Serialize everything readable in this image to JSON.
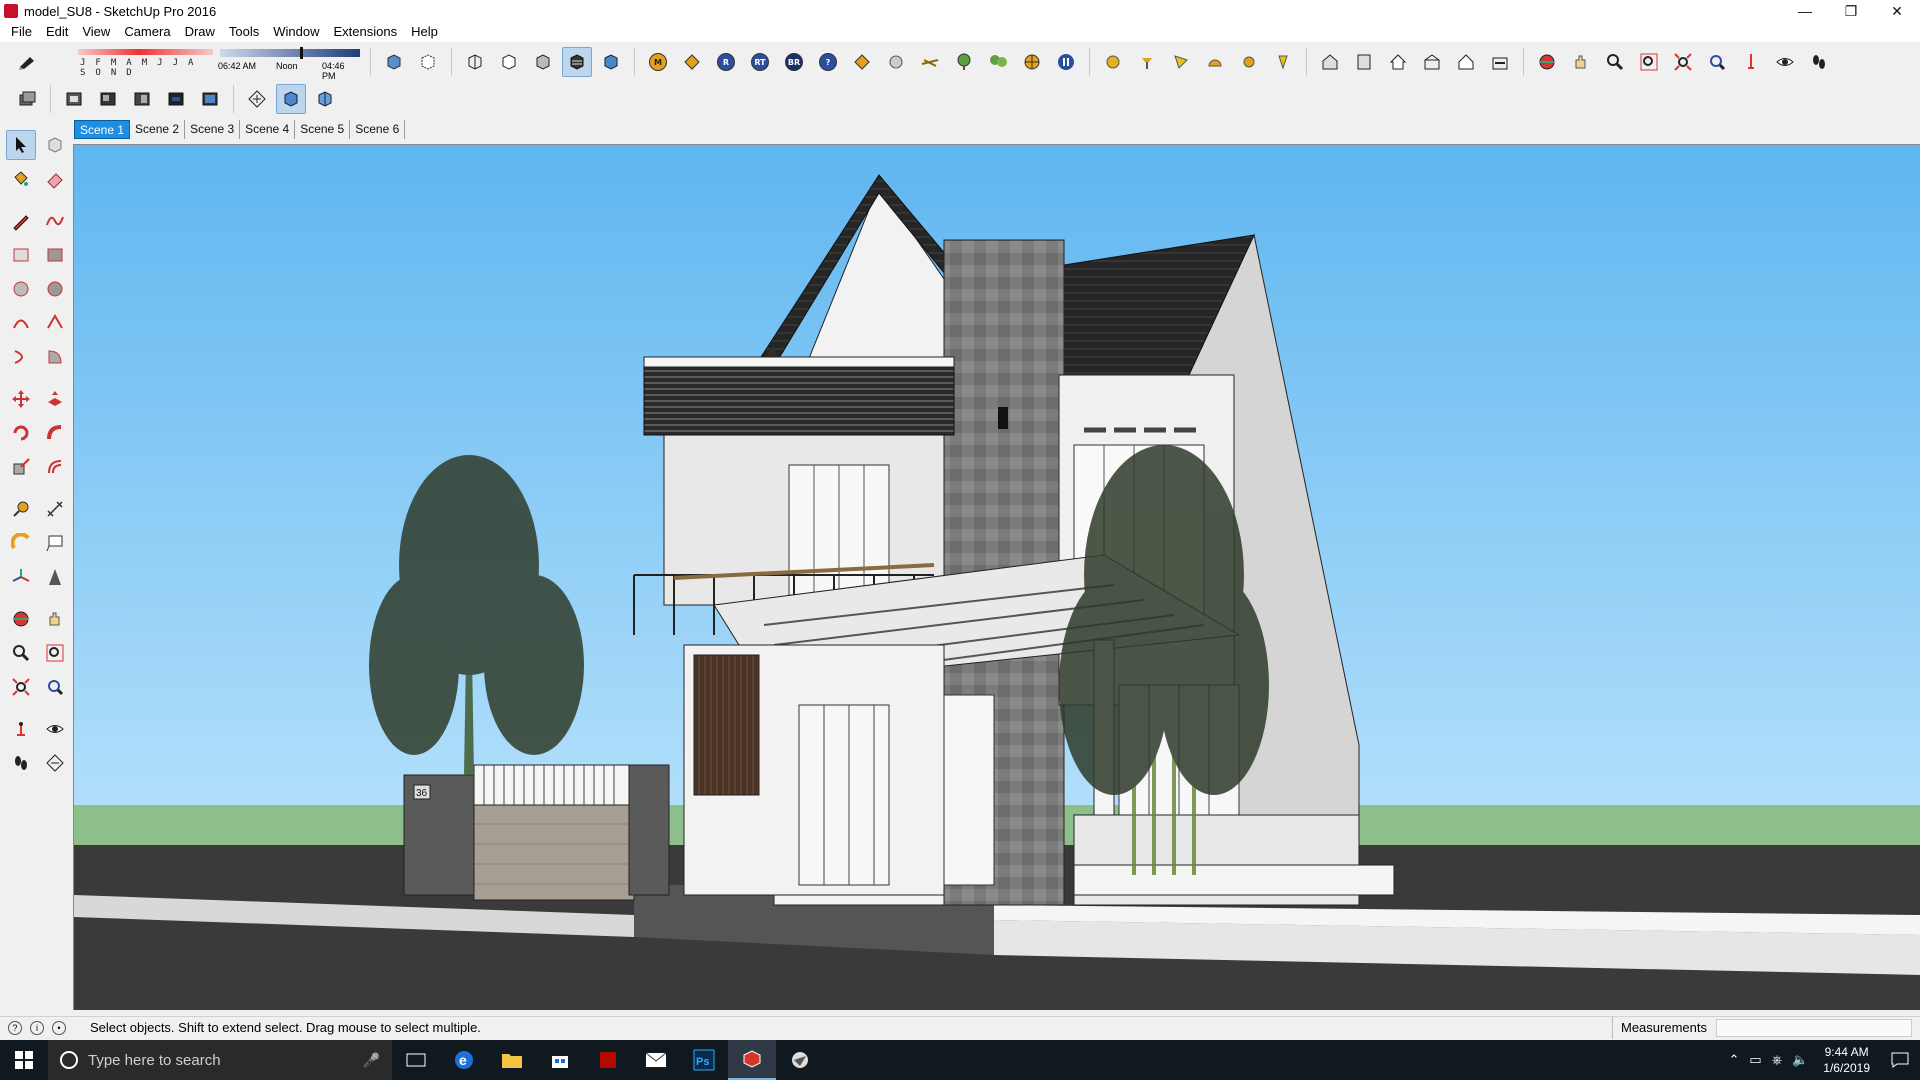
{
  "window": {
    "title": "model_SU8 - SketchUp Pro 2016",
    "minimize": "—",
    "restore": "❐",
    "close": "✕"
  },
  "menu": [
    "File",
    "Edit",
    "View",
    "Camera",
    "Draw",
    "Tools",
    "Window",
    "Extensions",
    "Help"
  ],
  "shadow": {
    "months": "J F M A M J J A S O N D",
    "time_start": "06:42 AM",
    "time_noon": "Noon",
    "time_end": "04:46 PM"
  },
  "toolbar_balls": [
    "M",
    "R",
    "RT",
    "BR",
    "?"
  ],
  "scenes": [
    "Scene 1",
    "Scene 2",
    "Scene 3",
    "Scene 4",
    "Scene 5",
    "Scene 6"
  ],
  "active_scene": "Scene 1",
  "house": {
    "gate_number": "36"
  },
  "status": {
    "text": "Select objects. Shift to extend select. Drag mouse to select multiple.",
    "measurements_label": "Measurements",
    "measurements_value": ""
  },
  "taskbar": {
    "search_placeholder": "Type here to search",
    "time": "9:44 AM",
    "date": "1/6/2019"
  },
  "colors": {
    "sky": "#6bbcf2",
    "ground": "#3a3a3a",
    "grass": "#8dbf8a",
    "accent": "#1e8fe0",
    "roof": "#2b2b2b",
    "stone": "#7a7a7a"
  }
}
